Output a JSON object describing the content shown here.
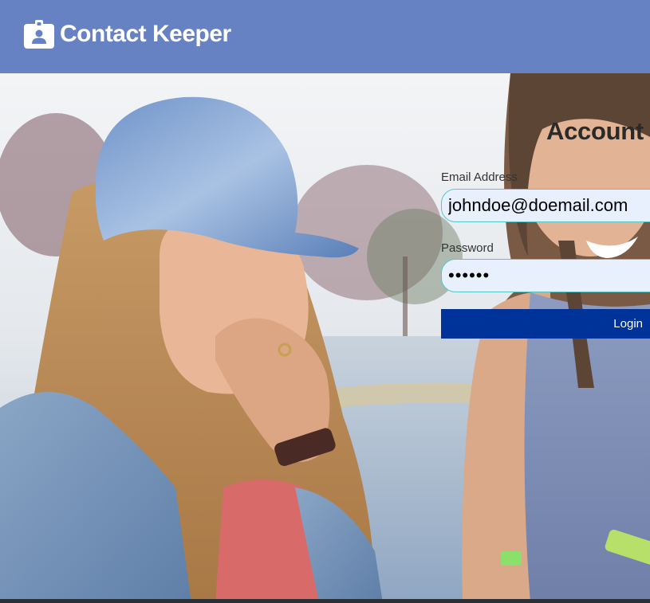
{
  "navbar": {
    "brand_name": "Contact Keeper",
    "brand_icon": "id-badge-icon",
    "background": "#6682c2"
  },
  "login_form": {
    "title": "Account Login",
    "email": {
      "label": "Email Address",
      "value": "johndoe@doemail.com"
    },
    "password": {
      "label": "Password",
      "value": "••••••"
    },
    "submit_label": "Login",
    "submit_color": "#003399"
  },
  "background_image": "two-smiling-girls-photo"
}
